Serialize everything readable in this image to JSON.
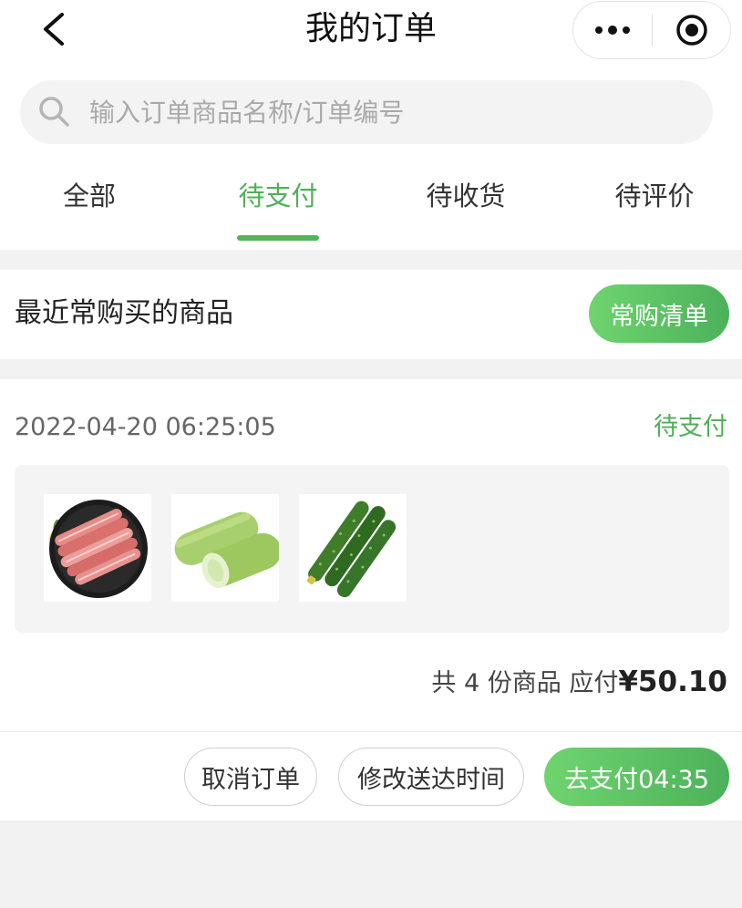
{
  "nav": {
    "title": "我的订单"
  },
  "search": {
    "placeholder": "输入订单商品名称/订单编号"
  },
  "tabs": [
    {
      "label": "全部"
    },
    {
      "label": "待支付",
      "active": true
    },
    {
      "label": "待收货"
    },
    {
      "label": "待评价"
    }
  ],
  "frequent": {
    "title": "最近常购买的商品",
    "button_label": "常购清单"
  },
  "order": {
    "time": "2022-04-20 06:25:05",
    "status": "待支付",
    "items": [
      {
        "icon": "sliced-beef-roll-image"
      },
      {
        "icon": "zucchini-image"
      },
      {
        "icon": "cucumber-image"
      }
    ],
    "summary_prefix": "共 4 份商品  应付",
    "price": "¥50.10",
    "buttons": {
      "cancel": "取消订单",
      "change_time": "修改送达时间",
      "pay": "去支付04:35"
    }
  },
  "colors": {
    "accent": "#4fb058",
    "button_gradient_start": "#6fd46f",
    "button_gradient_end": "#4cb15a",
    "background": "#f2f2f2"
  }
}
